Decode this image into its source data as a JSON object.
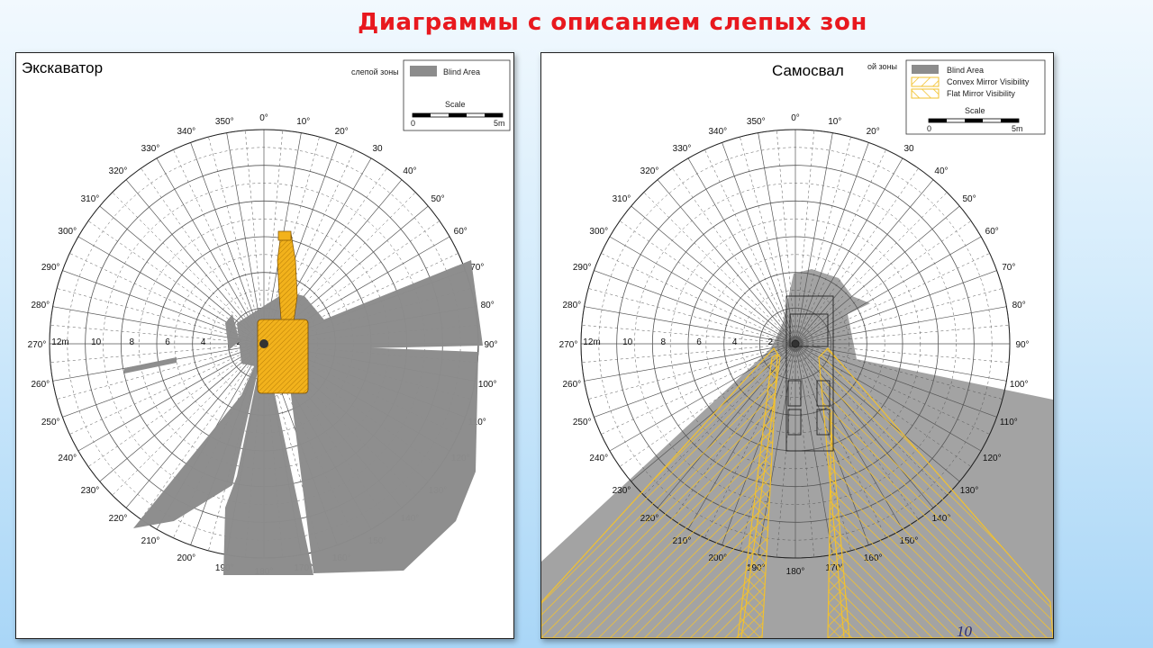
{
  "title": "Диаграммы с описанием слепых зон",
  "page_number": "10",
  "left_panel": {
    "label": "Экскаватор",
    "legend_caption": "слепой зоны",
    "legend": {
      "blind_area": "Blind Area",
      "scale_label": "Scale",
      "scale_min": "0",
      "scale_max": "5m"
    }
  },
  "right_panel": {
    "label": "Самосвал",
    "legend_caption": "ой зоны",
    "legend": {
      "blind_area": "Blind Area",
      "convex": "Convex Mirror Visibility",
      "flat": "Flat Mirror Visibility",
      "scale_label": "Scale",
      "scale_min": "0",
      "scale_max": "5m"
    }
  },
  "compass": {
    "degree_labels": [
      "0°",
      "10°",
      "20°",
      "30",
      "40°",
      "50°",
      "60°",
      "70°",
      "80°",
      "90°",
      "100°",
      "110°",
      "120°",
      "130°",
      "140°",
      "150°",
      "160°",
      "170°",
      "180°",
      "190°",
      "200°",
      "210°",
      "220°",
      "230°",
      "240°",
      "250°",
      "260°",
      "270°",
      "280°",
      "290°",
      "300°",
      "310°",
      "320°",
      "330°",
      "340°",
      "350°"
    ],
    "radial_labels": [
      "12m",
      "10",
      "8",
      "6",
      "4",
      "2"
    ]
  },
  "colors": {
    "title": "#e8181e",
    "blind_area": "#8c8c8c",
    "blind_area_truck": "#a3a3a3",
    "excavator_body": "#f2b21c",
    "mirror_hatch": "#f2c12e"
  }
}
